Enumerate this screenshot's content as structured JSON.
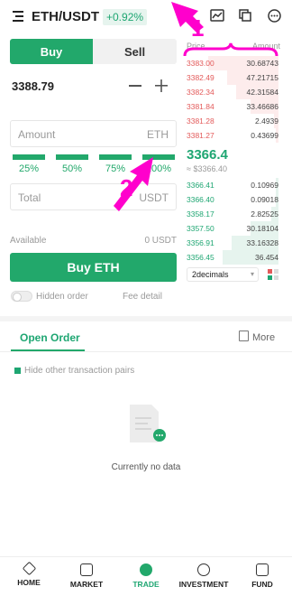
{
  "header": {
    "pair": "ETH/USDT",
    "change": "+0.92%"
  },
  "trade": {
    "buy_tab": "Buy",
    "sell_tab": "Sell",
    "price": "3388.79",
    "amount_placeholder": "Amount",
    "amount_unit": "ETH",
    "percent_options": [
      "25%",
      "50%",
      "75%",
      "100%"
    ],
    "total_placeholder": "Total",
    "total_unit": "USDT",
    "available_label": "Available",
    "available_value": "0 USDT",
    "buy_button": "Buy ETH",
    "hidden_order": "Hidden order",
    "fee_detail": "Fee detail"
  },
  "orderbook": {
    "price_label": "Price",
    "amount_label": "Amount",
    "asks": [
      {
        "price": "3383.00",
        "amount": "30.68743",
        "depth": 0.75
      },
      {
        "price": "3382.49",
        "amount": "47.21715",
        "depth": 0.55
      },
      {
        "price": "3382.34",
        "amount": "42.31584",
        "depth": 0.45
      },
      {
        "price": "3381.84",
        "amount": "33.46686",
        "depth": 0.3
      },
      {
        "price": "3381.28",
        "amount": "2.4939",
        "depth": 0.05
      },
      {
        "price": "3381.27",
        "amount": "0.43699",
        "depth": 0.03
      }
    ],
    "last_price": "3366.4",
    "last_price_usd": "≈ $3366.40",
    "bids": [
      {
        "price": "3366.41",
        "amount": "0.10969",
        "depth": 0.03
      },
      {
        "price": "3366.40",
        "amount": "0.09018",
        "depth": 0.03
      },
      {
        "price": "3358.17",
        "amount": "2.82525",
        "depth": 0.08
      },
      {
        "price": "3357.50",
        "amount": "30.18104",
        "depth": 0.3
      },
      {
        "price": "3356.91",
        "amount": "33.16328",
        "depth": 0.5
      },
      {
        "price": "3356.45",
        "amount": "36.454",
        "depth": 0.6
      }
    ],
    "decimals": "2decimals"
  },
  "orders": {
    "tab_label": "Open Order",
    "more_label": "More",
    "hide_pairs_label": "Hide other transaction pairs",
    "empty_text": "Currently no data"
  },
  "nav": [
    "HOME",
    "MARKET",
    "TRADE",
    "INVESTMENT",
    "FUND"
  ],
  "annotations": [
    "1",
    "2"
  ],
  "colors": {
    "green": "#22a86b",
    "red": "#e35a5a",
    "annotation": "#ff00cc"
  }
}
